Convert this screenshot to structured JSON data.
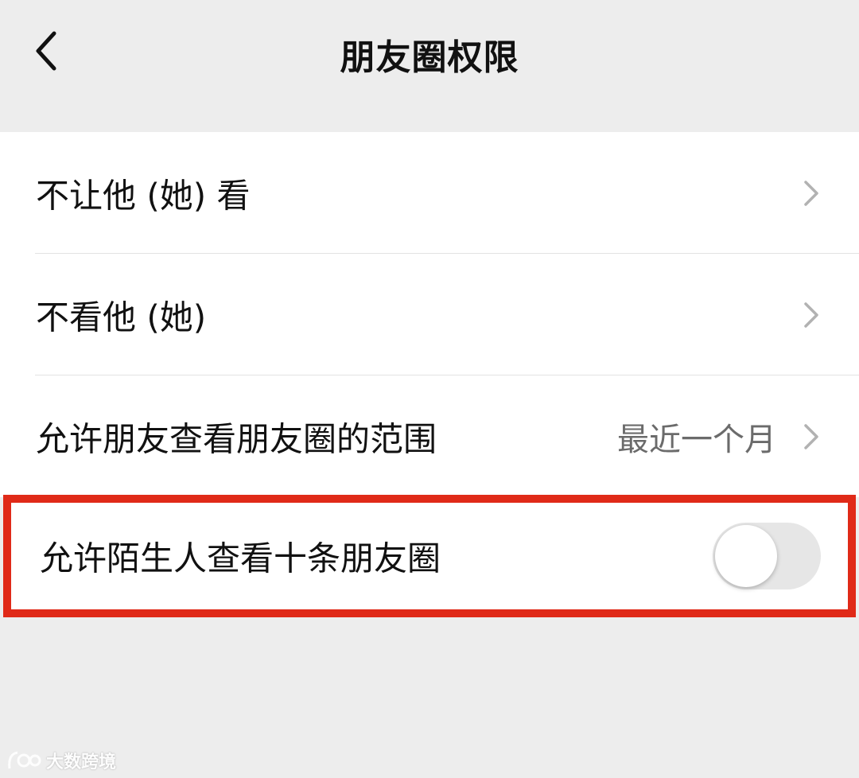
{
  "nav": {
    "title": "朋友圈权限",
    "back_icon": "chevron-left-icon"
  },
  "rows": [
    {
      "label": "不让他 (她) 看",
      "value": "",
      "icon": "chevron-right-icon"
    },
    {
      "label": "不看他 (她)",
      "value": "",
      "icon": "chevron-right-icon"
    },
    {
      "label": "允许朋友查看朋友圈的范围",
      "value": "最近一个月",
      "icon": "chevron-right-icon"
    },
    {
      "label": "允许陌生人查看十条朋友圈",
      "toggle_on": false
    }
  ],
  "highlight_color": "#e02a18",
  "watermark": {
    "text": "大数跨境",
    "logo": "100"
  }
}
